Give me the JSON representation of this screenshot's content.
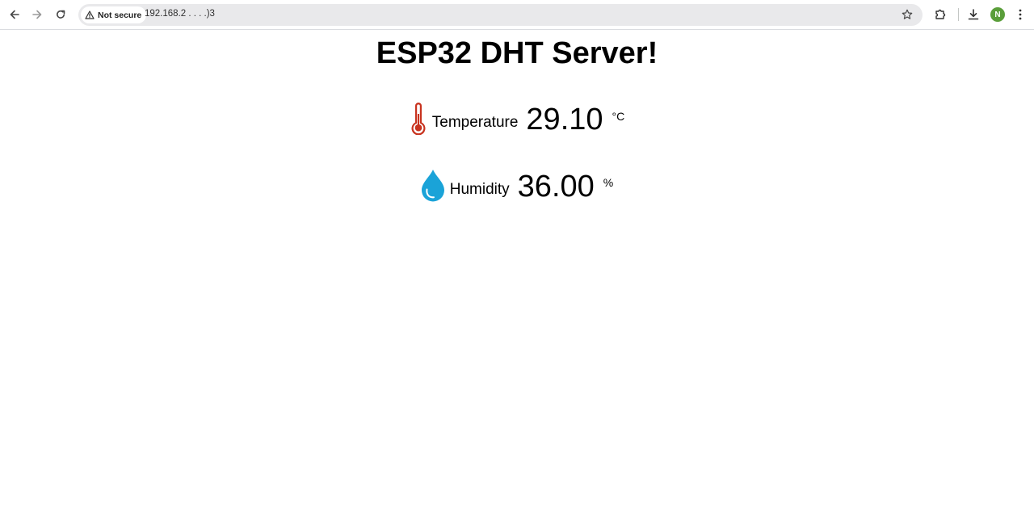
{
  "browser": {
    "security_label": "Not secure",
    "url": "192.168.2  . . .  .)3",
    "avatar_initial": "N",
    "avatar_color": "#5a9e3a"
  },
  "page": {
    "title": "ESP32 DHT Server!",
    "temperature": {
      "icon": "thermometer-icon",
      "icon_color": "#c8331f",
      "label": "Temperature",
      "value": "29.10",
      "unit": "°C"
    },
    "humidity": {
      "icon": "water-drop-icon",
      "icon_color": "#1aa3d8",
      "label": "Humidity",
      "value": "36.00",
      "unit": "%"
    }
  }
}
